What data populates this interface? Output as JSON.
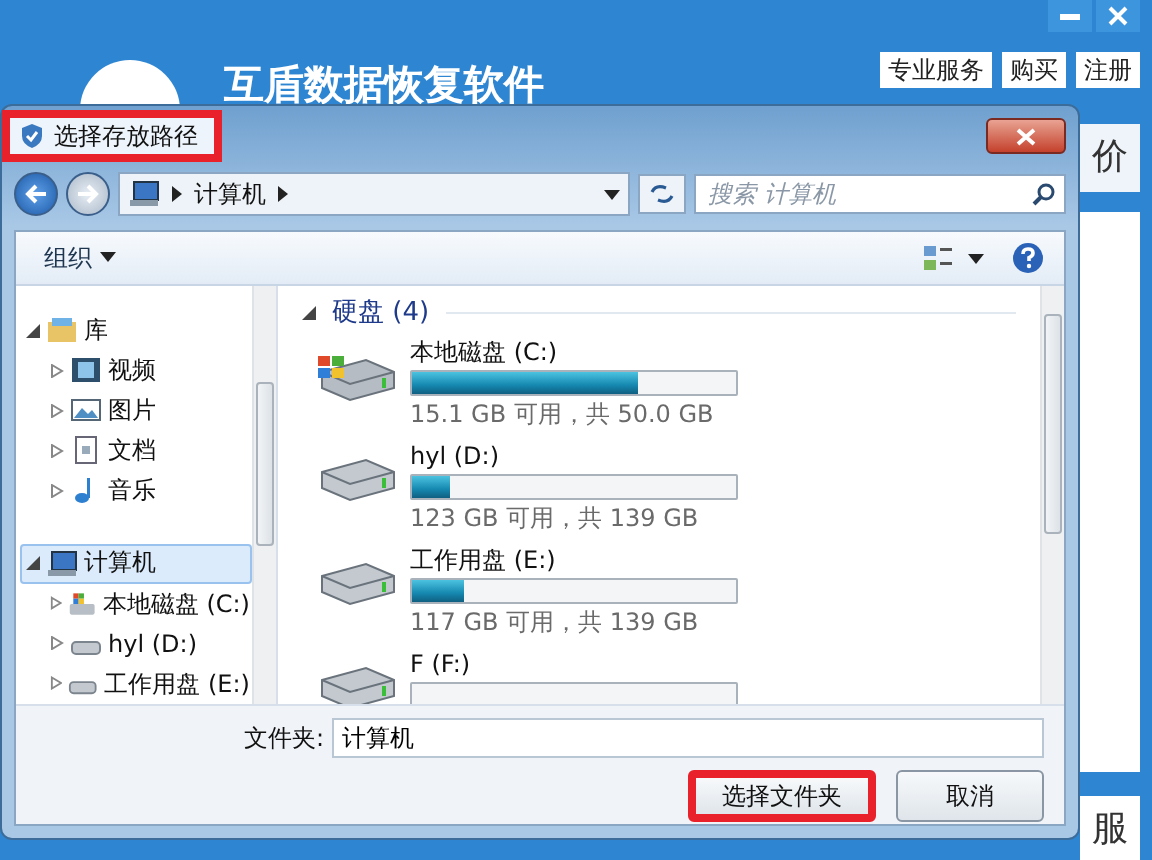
{
  "app": {
    "title": "互盾数据恢复软件",
    "header_buttons": [
      "专业服务",
      "购买",
      "注册"
    ],
    "side_texts": [
      "价",
      "服"
    ]
  },
  "dialog": {
    "title": "选择存放路径",
    "title_highlighted": true,
    "address": {
      "crumbs": [
        "计算机"
      ]
    },
    "search": {
      "placeholder": "搜索 计算机"
    },
    "toolbar": {
      "organize": "组织"
    },
    "nav": [
      {
        "label": "库",
        "kind": "library",
        "expanded": true,
        "selected": false,
        "children": [
          {
            "label": "视频",
            "kind": "video",
            "expanded": false,
            "selected": false
          },
          {
            "label": "图片",
            "kind": "picture",
            "expanded": false,
            "selected": false
          },
          {
            "label": "文档",
            "kind": "document",
            "expanded": false,
            "selected": false
          },
          {
            "label": "音乐",
            "kind": "music",
            "expanded": false,
            "selected": false
          }
        ]
      },
      {
        "label": "计算机",
        "kind": "computer",
        "expanded": true,
        "selected": true,
        "children": [
          {
            "label": "本地磁盘 (C:)",
            "kind": "systemdrive",
            "expanded": false,
            "selected": false
          },
          {
            "label": "hyl (D:)",
            "kind": "drive",
            "expanded": false,
            "selected": false
          },
          {
            "label": "工作用盘 (E:)",
            "kind": "drive",
            "expanded": false,
            "selected": false
          }
        ]
      }
    ],
    "group": {
      "label": "硬盘 (4)",
      "expanded": true
    },
    "drives": [
      {
        "name": "本地磁盘 (C:)",
        "kind": "system",
        "level": 0.7,
        "info": "15.1 GB 可用，共 50.0 GB"
      },
      {
        "name": "hyl (D:)",
        "kind": "data",
        "level": 0.12,
        "info": "123 GB 可用，共 139 GB"
      },
      {
        "name": "工作用盘 (E:)",
        "kind": "data",
        "level": 0.16,
        "info": "117 GB 可用，共 139 GB"
      },
      {
        "name": "F (F:)",
        "kind": "data"
      }
    ],
    "folder": {
      "label": "文件夹:",
      "value": "计算机"
    },
    "buttons": [
      {
        "label": "选择文件夹",
        "highlighted": true
      },
      {
        "label": "取消",
        "highlighted": false
      }
    ]
  }
}
